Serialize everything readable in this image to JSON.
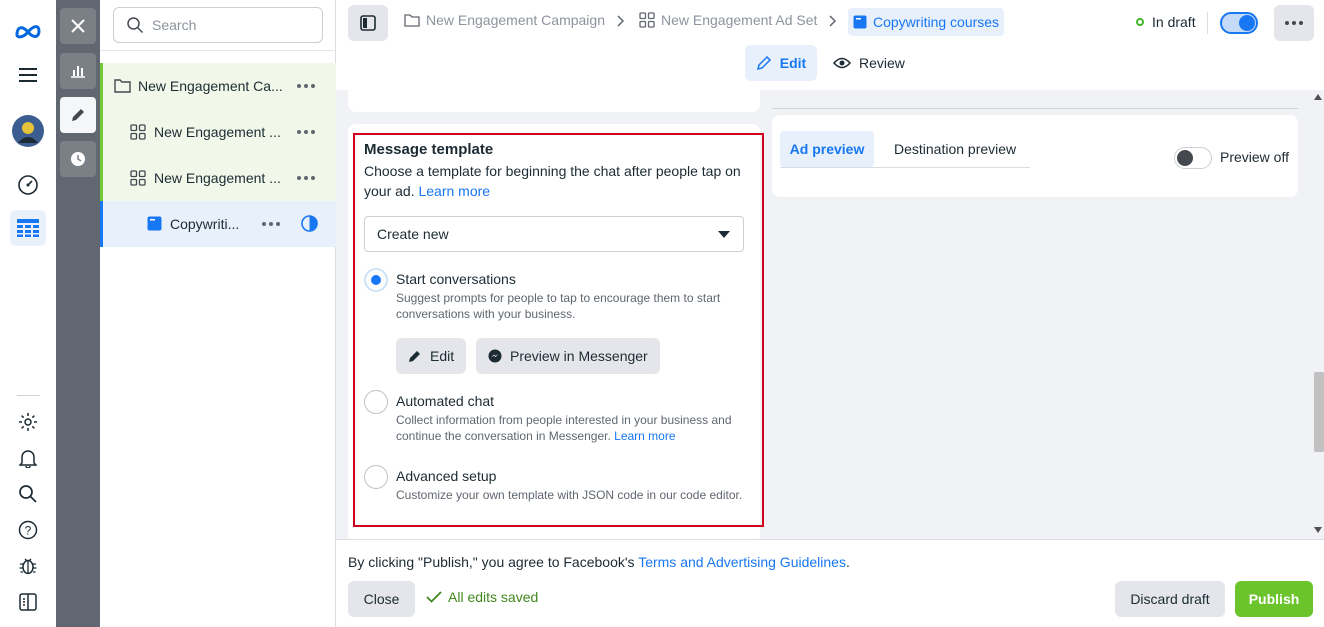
{
  "search": {
    "placeholder": "Search"
  },
  "tree": {
    "items": [
      {
        "label": "New Engagement Ca...",
        "type": "campaign"
      },
      {
        "label": "New Engagement ...",
        "type": "adset"
      },
      {
        "label": "New Engagement ...",
        "type": "adset"
      },
      {
        "label": "Copywriti...",
        "type": "ad"
      }
    ]
  },
  "breadcrumb": {
    "items": [
      {
        "label": "New Engagement Campaign",
        "icon": "folder-icon"
      },
      {
        "label": "New Engagement Ad Set",
        "icon": "grid-icon"
      },
      {
        "label": "Copywriting courses",
        "icon": "ad-icon"
      }
    ]
  },
  "header": {
    "status": "In draft",
    "edit_tab": "Edit",
    "review_tab": "Review"
  },
  "message_template": {
    "title": "Message template",
    "description": "Choose a template for beginning the chat after people tap on your ad.",
    "learn_more": "Learn more",
    "select_value": "Create new",
    "options": [
      {
        "title": "Start conversations",
        "description": "Suggest prompts for people to tap to encourage them to start conversations with your business.",
        "selected": true
      },
      {
        "title": "Automated chat",
        "description": "Collect information from people interested in your business and continue the conversation in Messenger.",
        "learn_more": "Learn more",
        "selected": false
      },
      {
        "title": "Advanced setup",
        "description": "Customize your own template with JSON code in our code editor.",
        "selected": false
      }
    ],
    "edit_button": "Edit",
    "preview_button": "Preview in Messenger"
  },
  "preview": {
    "tabs": [
      "Ad preview",
      "Destination preview"
    ],
    "active_tab": "Ad preview",
    "toggle_label": "Preview off",
    "toggle_on": false
  },
  "footer": {
    "terms_prefix": "By clicking \"Publish,\" you agree to Facebook's",
    "terms_link": "Terms and Advertising Guidelines",
    "terms_suffix": ".",
    "close_button": "Close",
    "saved_status": "All edits saved",
    "discard_button": "Discard draft",
    "publish_button": "Publish"
  },
  "colors": {
    "accent": "#1877f2",
    "publish": "#6bc42b",
    "highlight_border": "#d0021b",
    "tree_active_bg": "#f1f8ea"
  }
}
